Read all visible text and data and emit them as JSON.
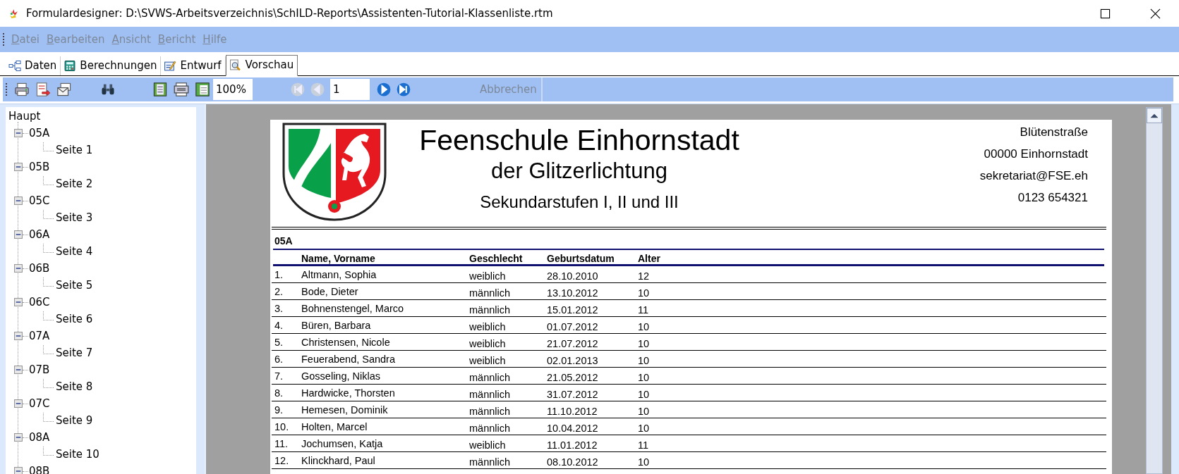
{
  "window": {
    "title": "Formulardesigner: D:\\SVWS-Arbeitsverzeichnis\\SchILD-Reports\\Assistenten-Tutorial-Klassenliste.rtm"
  },
  "menu": [
    {
      "label": "Datei",
      "disabled": true
    },
    {
      "label": "Bearbeiten",
      "disabled": true
    },
    {
      "label": "Ansicht",
      "disabled": true
    },
    {
      "label": "Bericht",
      "disabled": true
    },
    {
      "label": "Hilfe",
      "disabled": true
    }
  ],
  "tabs": [
    {
      "label": "Daten",
      "selected": false
    },
    {
      "label": "Berechnungen",
      "selected": false
    },
    {
      "label": "Entwurf",
      "selected": false
    },
    {
      "label": "Vorschau",
      "selected": true
    }
  ],
  "toolbar": {
    "zoom": {
      "value": "100%"
    },
    "page": {
      "value": "1"
    },
    "nav": [
      {
        "kind": "first",
        "disabled": true
      },
      {
        "kind": "prev",
        "disabled": true
      },
      {
        "kind": "next",
        "disabled": false
      },
      {
        "kind": "last",
        "disabled": false
      }
    ],
    "cancel": {
      "label": "Abbrechen",
      "disabled": true
    }
  },
  "tree": {
    "root": "Haupt",
    "children": [
      {
        "label": "05A",
        "expanded": true,
        "children": [
          {
            "label": "Seite 1"
          }
        ]
      },
      {
        "label": "05B",
        "expanded": true,
        "children": [
          {
            "label": "Seite 2"
          }
        ]
      },
      {
        "label": "05C",
        "expanded": true,
        "children": [
          {
            "label": "Seite 3"
          }
        ]
      },
      {
        "label": "06A",
        "expanded": true,
        "children": [
          {
            "label": "Seite 4"
          }
        ]
      },
      {
        "label": "06B",
        "expanded": true,
        "children": [
          {
            "label": "Seite 5"
          }
        ]
      },
      {
        "label": "06C",
        "expanded": true,
        "children": [
          {
            "label": "Seite 6"
          }
        ]
      },
      {
        "label": "07A",
        "expanded": true,
        "children": [
          {
            "label": "Seite 7"
          }
        ]
      },
      {
        "label": "07B",
        "expanded": true,
        "children": [
          {
            "label": "Seite 8"
          }
        ]
      },
      {
        "label": "07C",
        "expanded": true,
        "children": [
          {
            "label": "Seite 9"
          }
        ]
      },
      {
        "label": "08A",
        "expanded": true,
        "children": [
          {
            "label": "Seite 10"
          }
        ]
      },
      {
        "label": "08B",
        "expanded": true
      }
    ]
  },
  "preview": {
    "school": {
      "name": "Feenschule Einhornstadt",
      "subtitle": "der Glitzerlichtung",
      "levels": "Sekundarstufen I, II und III"
    },
    "address": [
      "Blütenstraße",
      "00000 Einhornstadt",
      "sekretariat@FSE.eh",
      "0123 654321"
    ],
    "group": "05A",
    "table": {
      "columns": [
        "",
        "Name, Vorname",
        "Geschlecht",
        "Geburtsdatum",
        "Alter"
      ],
      "rows": [
        [
          "1.",
          "Altmann, Sophia",
          "weiblich",
          "28.10.2010",
          "12"
        ],
        [
          "2.",
          "Bode, Dieter",
          "männlich",
          "13.10.2012",
          "10"
        ],
        [
          "3.",
          "Bohnenstengel, Marco",
          "männlich",
          "15.01.2012",
          "11"
        ],
        [
          "4.",
          "Büren, Barbara",
          "weiblich",
          "01.07.2012",
          "10"
        ],
        [
          "5.",
          "Christensen, Nicole",
          "weiblich",
          "21.07.2012",
          "10"
        ],
        [
          "6.",
          "Feuerabend, Sandra",
          "weiblich",
          "02.01.2013",
          "10"
        ],
        [
          "7.",
          "Gosseling, Niklas",
          "männlich",
          "21.05.2012",
          "10"
        ],
        [
          "8.",
          "Hardwicke, Thorsten",
          "männlich",
          "31.07.2012",
          "10"
        ],
        [
          "9.",
          "Hemesen, Dominik",
          "männlich",
          "11.10.2012",
          "10"
        ],
        [
          "10.",
          "Holten, Marcel",
          "männlich",
          "10.04.2012",
          "10"
        ],
        [
          "11.",
          "Jochumsen, Katja",
          "weiblich",
          "11.01.2012",
          "11"
        ],
        [
          "12.",
          "Klinckhard, Paul",
          "männlich",
          "08.10.2012",
          "10"
        ]
      ]
    }
  }
}
